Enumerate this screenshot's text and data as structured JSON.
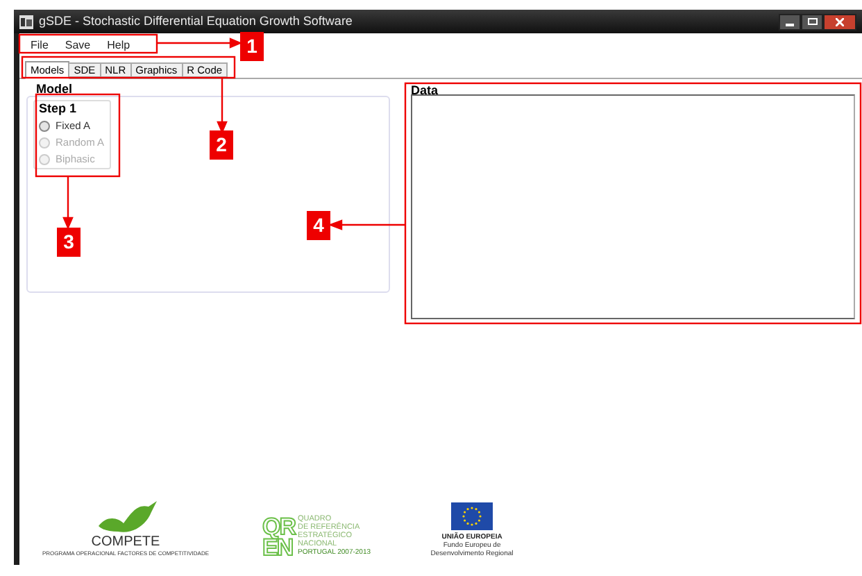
{
  "window": {
    "title": "gSDE - Stochastic Differential Equation Growth Software"
  },
  "menu": [
    "File",
    "Save",
    "Help"
  ],
  "tabs": [
    {
      "label": "Models",
      "selected": true
    },
    {
      "label": "SDE",
      "selected": false
    },
    {
      "label": "NLR",
      "selected": false
    },
    {
      "label": "Graphics",
      "selected": false
    },
    {
      "label": "R Code",
      "selected": false
    }
  ],
  "model_panel": {
    "title": "Model",
    "step": {
      "title": "Step 1",
      "options": [
        {
          "label": "Fixed A",
          "selected": false,
          "disabled": false
        },
        {
          "label": "Random A",
          "selected": false,
          "disabled": true
        },
        {
          "label": "Biphasic",
          "selected": false,
          "disabled": true
        }
      ]
    }
  },
  "data_panel": {
    "title": "Data"
  },
  "logos": [
    {
      "kind": "compete",
      "name": "COMPETE",
      "caption": "PROGRAMA OPERACIONAL FACTORES DE COMPETITIVIDADE"
    },
    {
      "kind": "qren",
      "letters": [
        "QR",
        "EN"
      ],
      "lines": [
        "QUADRO",
        "DE REFERÊNCIA",
        "ESTRATÉGICO",
        "NACIONAL"
      ],
      "caption": "PORTUGAL 2007-2013"
    },
    {
      "kind": "eu",
      "name": "UNIÃO EUROPEIA",
      "caption": "Fundo Europeu de Desenvolvimento Regional"
    }
  ],
  "annotations": [
    {
      "label": "1"
    },
    {
      "label": "2"
    },
    {
      "label": "3"
    },
    {
      "label": "4"
    }
  ]
}
